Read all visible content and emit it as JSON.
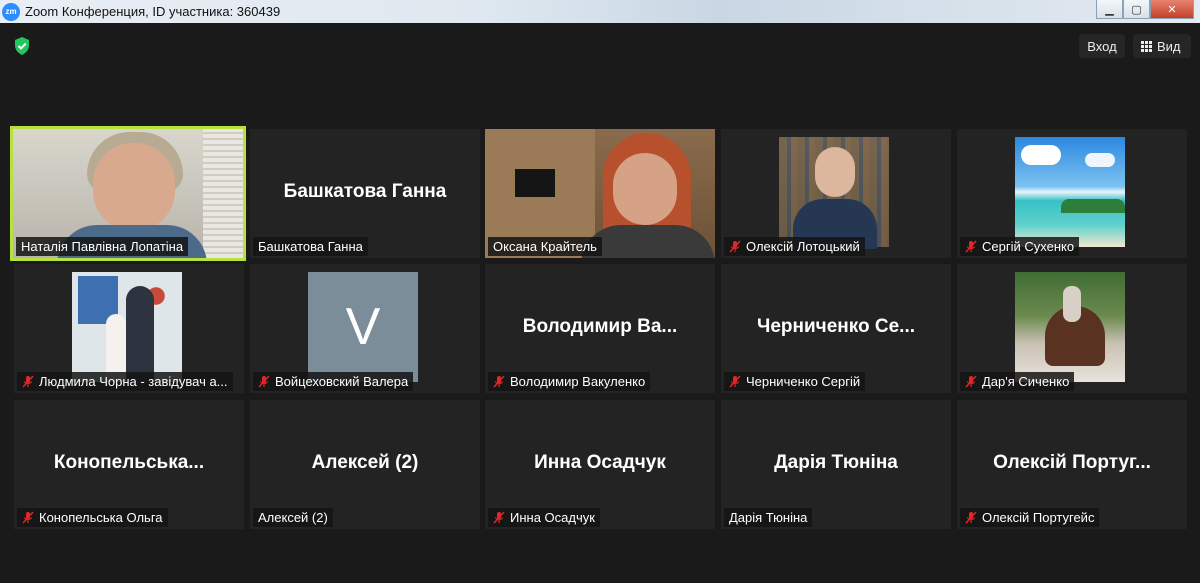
{
  "window": {
    "app_icon_text": "zm",
    "title": "Zoom Конференция, ID участника: 360439",
    "minimize": "▁",
    "maximize": "▢",
    "close": "✕"
  },
  "toolbar": {
    "exit_label": "Вход",
    "view_label": "Вид"
  },
  "tiles": [
    {
      "label": "Наталія Павлівна Лопатіна",
      "big_name": "",
      "muted": false,
      "active": true
    },
    {
      "label": "Башкатова Ганна",
      "big_name": "Башкатова Ганна",
      "muted": false,
      "active": false
    },
    {
      "label": "Оксана Крайтель",
      "big_name": "",
      "muted": false,
      "active": false
    },
    {
      "label": "Олексій Лотоцький",
      "big_name": "",
      "muted": true,
      "active": false
    },
    {
      "label": "Сергій Сухенко",
      "big_name": "",
      "muted": true,
      "active": false
    },
    {
      "label": "Людмила Чорна - завідувач а...",
      "big_name": "",
      "muted": true,
      "active": false
    },
    {
      "label": "Войцеховский Валера",
      "big_name": "",
      "avatar_letter": "V",
      "muted": true,
      "active": false
    },
    {
      "label": "Володимир Вакуленко",
      "big_name": "Володимир Ва...",
      "muted": true,
      "active": false
    },
    {
      "label": "Черниченко Сергій",
      "big_name": "Черниченко Се...",
      "muted": true,
      "active": false
    },
    {
      "label": "Дар'я Сиченко",
      "big_name": "",
      "muted": true,
      "active": false
    },
    {
      "label": "Конопельська Ольга",
      "big_name": "Конопельська...",
      "muted": true,
      "active": false
    },
    {
      "label": "Алексей (2)",
      "big_name": "Алексей (2)",
      "muted": false,
      "active": false
    },
    {
      "label": "Инна Осадчук",
      "big_name": "Инна Осадчук",
      "muted": true,
      "active": false
    },
    {
      "label": "Дарія Тюніна",
      "big_name": "Дарія Тюніна",
      "muted": false,
      "active": false
    },
    {
      "label": "Олексій Португейс",
      "big_name": "Олексій Португ...",
      "muted": true,
      "active": false
    }
  ],
  "colors": {
    "active_speaker_border": "#b7e23c",
    "mute_red": "#e02828",
    "shield_green": "#23c55e"
  }
}
